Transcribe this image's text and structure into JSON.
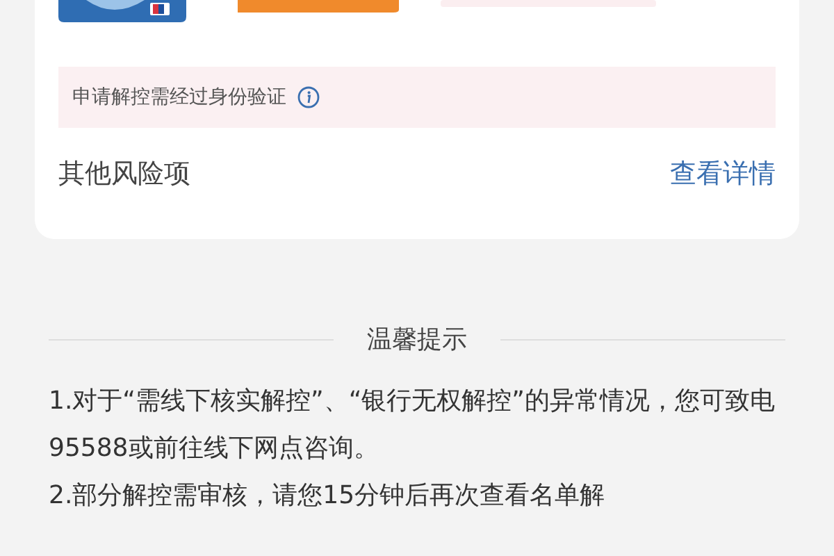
{
  "verification_notice": {
    "text": "申请解控需经过身份验证"
  },
  "other_risks": {
    "label": "其他风险项",
    "link": "查看详情"
  },
  "tips": {
    "title": "温馨提示",
    "lines": [
      "1.对于“需线下核实解控”、“银行无权解控”的异常情况，您可致电95588或前往线下网点咨询。",
      "2.部分解控需审核，请您15分钟后再次查看名单解"
    ]
  }
}
